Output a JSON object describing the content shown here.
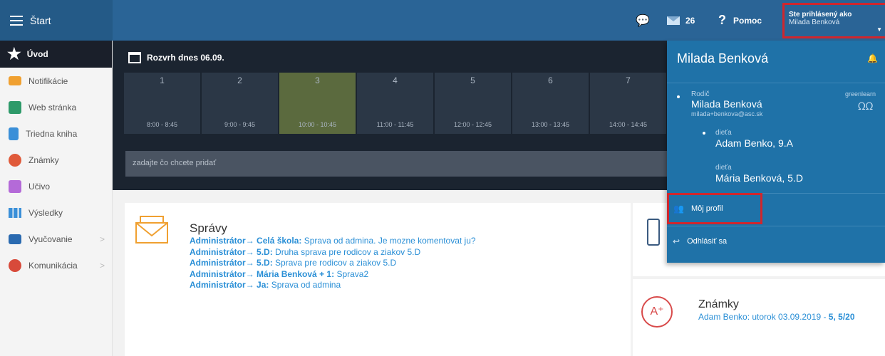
{
  "header": {
    "start_label": "Štart",
    "mail_count": "26",
    "help_label": "Pomoc",
    "login_title": "Ste prihlásený ako",
    "login_name": "Milada Benková"
  },
  "sidebar": {
    "items": [
      {
        "label": "Úvod",
        "icon": "star-icon"
      },
      {
        "label": "Notifikácie",
        "icon": "envelope-icon"
      },
      {
        "label": "Web stránka",
        "icon": "home-icon"
      },
      {
        "label": "Triedna kniha",
        "icon": "book-icon"
      },
      {
        "label": "Známky",
        "icon": "grade-icon"
      },
      {
        "label": "Učivo",
        "icon": "student-icon"
      },
      {
        "label": "Výsledky",
        "icon": "bar-chart-icon"
      },
      {
        "label": "Vyučovanie",
        "icon": "classroom-icon"
      },
      {
        "label": "Komunikácia",
        "icon": "chat-icon"
      }
    ]
  },
  "timetable": {
    "title": "Rozvrh dnes 06.09.",
    "periods": [
      {
        "num": "1",
        "time": "8:00 - 8:45"
      },
      {
        "num": "2",
        "time": "9:00 - 9:45"
      },
      {
        "num": "3",
        "time": "10:00 - 10:45"
      },
      {
        "num": "4",
        "time": "11:00 - 11:45"
      },
      {
        "num": "5",
        "time": "12:00 - 12:45"
      },
      {
        "num": "6",
        "time": "13:00 - 13:45"
      },
      {
        "num": "7",
        "time": "14:00 - 14:45"
      }
    ],
    "current_period": "3",
    "add_placeholder": "zadajte čo chcete pridať"
  },
  "messages": {
    "title": "Správy",
    "items": [
      {
        "from": "Administrátor",
        "to": "Celá škola:",
        "text": "Sprava od admina. Je mozne komentovat ju?"
      },
      {
        "from": "Administrátor",
        "to": "5.D:",
        "text": "Druha sprava pre rodicov a ziakov 5.D"
      },
      {
        "from": "Administrátor",
        "to": "5.D:",
        "text": "Sprava pre rodicov a ziakov 5.D"
      },
      {
        "from": "Administrátor",
        "to": "Mária Benková + 1:",
        "text": "Sprava2"
      },
      {
        "from": "Administrátor",
        "to": "Ja:",
        "text": "Sprava od admina"
      }
    ]
  },
  "grades": {
    "title": "Známky",
    "line": "Adam Benko: utorok 03.09.2019 -",
    "value": "5, 5/20"
  },
  "dropdown": {
    "name": "Milada Benková",
    "parent_role": "Rodič",
    "parent_name": "Milada Benková",
    "parent_email": "milada+benkova@asc.sk",
    "brand": "greenlearn",
    "children": [
      {
        "role": "dieťa",
        "name": "Adam Benko, 9.A"
      },
      {
        "role": "dieťa",
        "name": "Mária Benková, 5.D"
      }
    ],
    "profile_label": "Môj profil",
    "logout_label": "Odhlásiť sa"
  },
  "colors": {
    "topbar": "#2a6496",
    "dark_panel": "#1b2430",
    "current_period": "#5b6a3e",
    "dropdown": "#1f72a8",
    "highlight": "#d0262d",
    "link": "#2a8fd6"
  }
}
